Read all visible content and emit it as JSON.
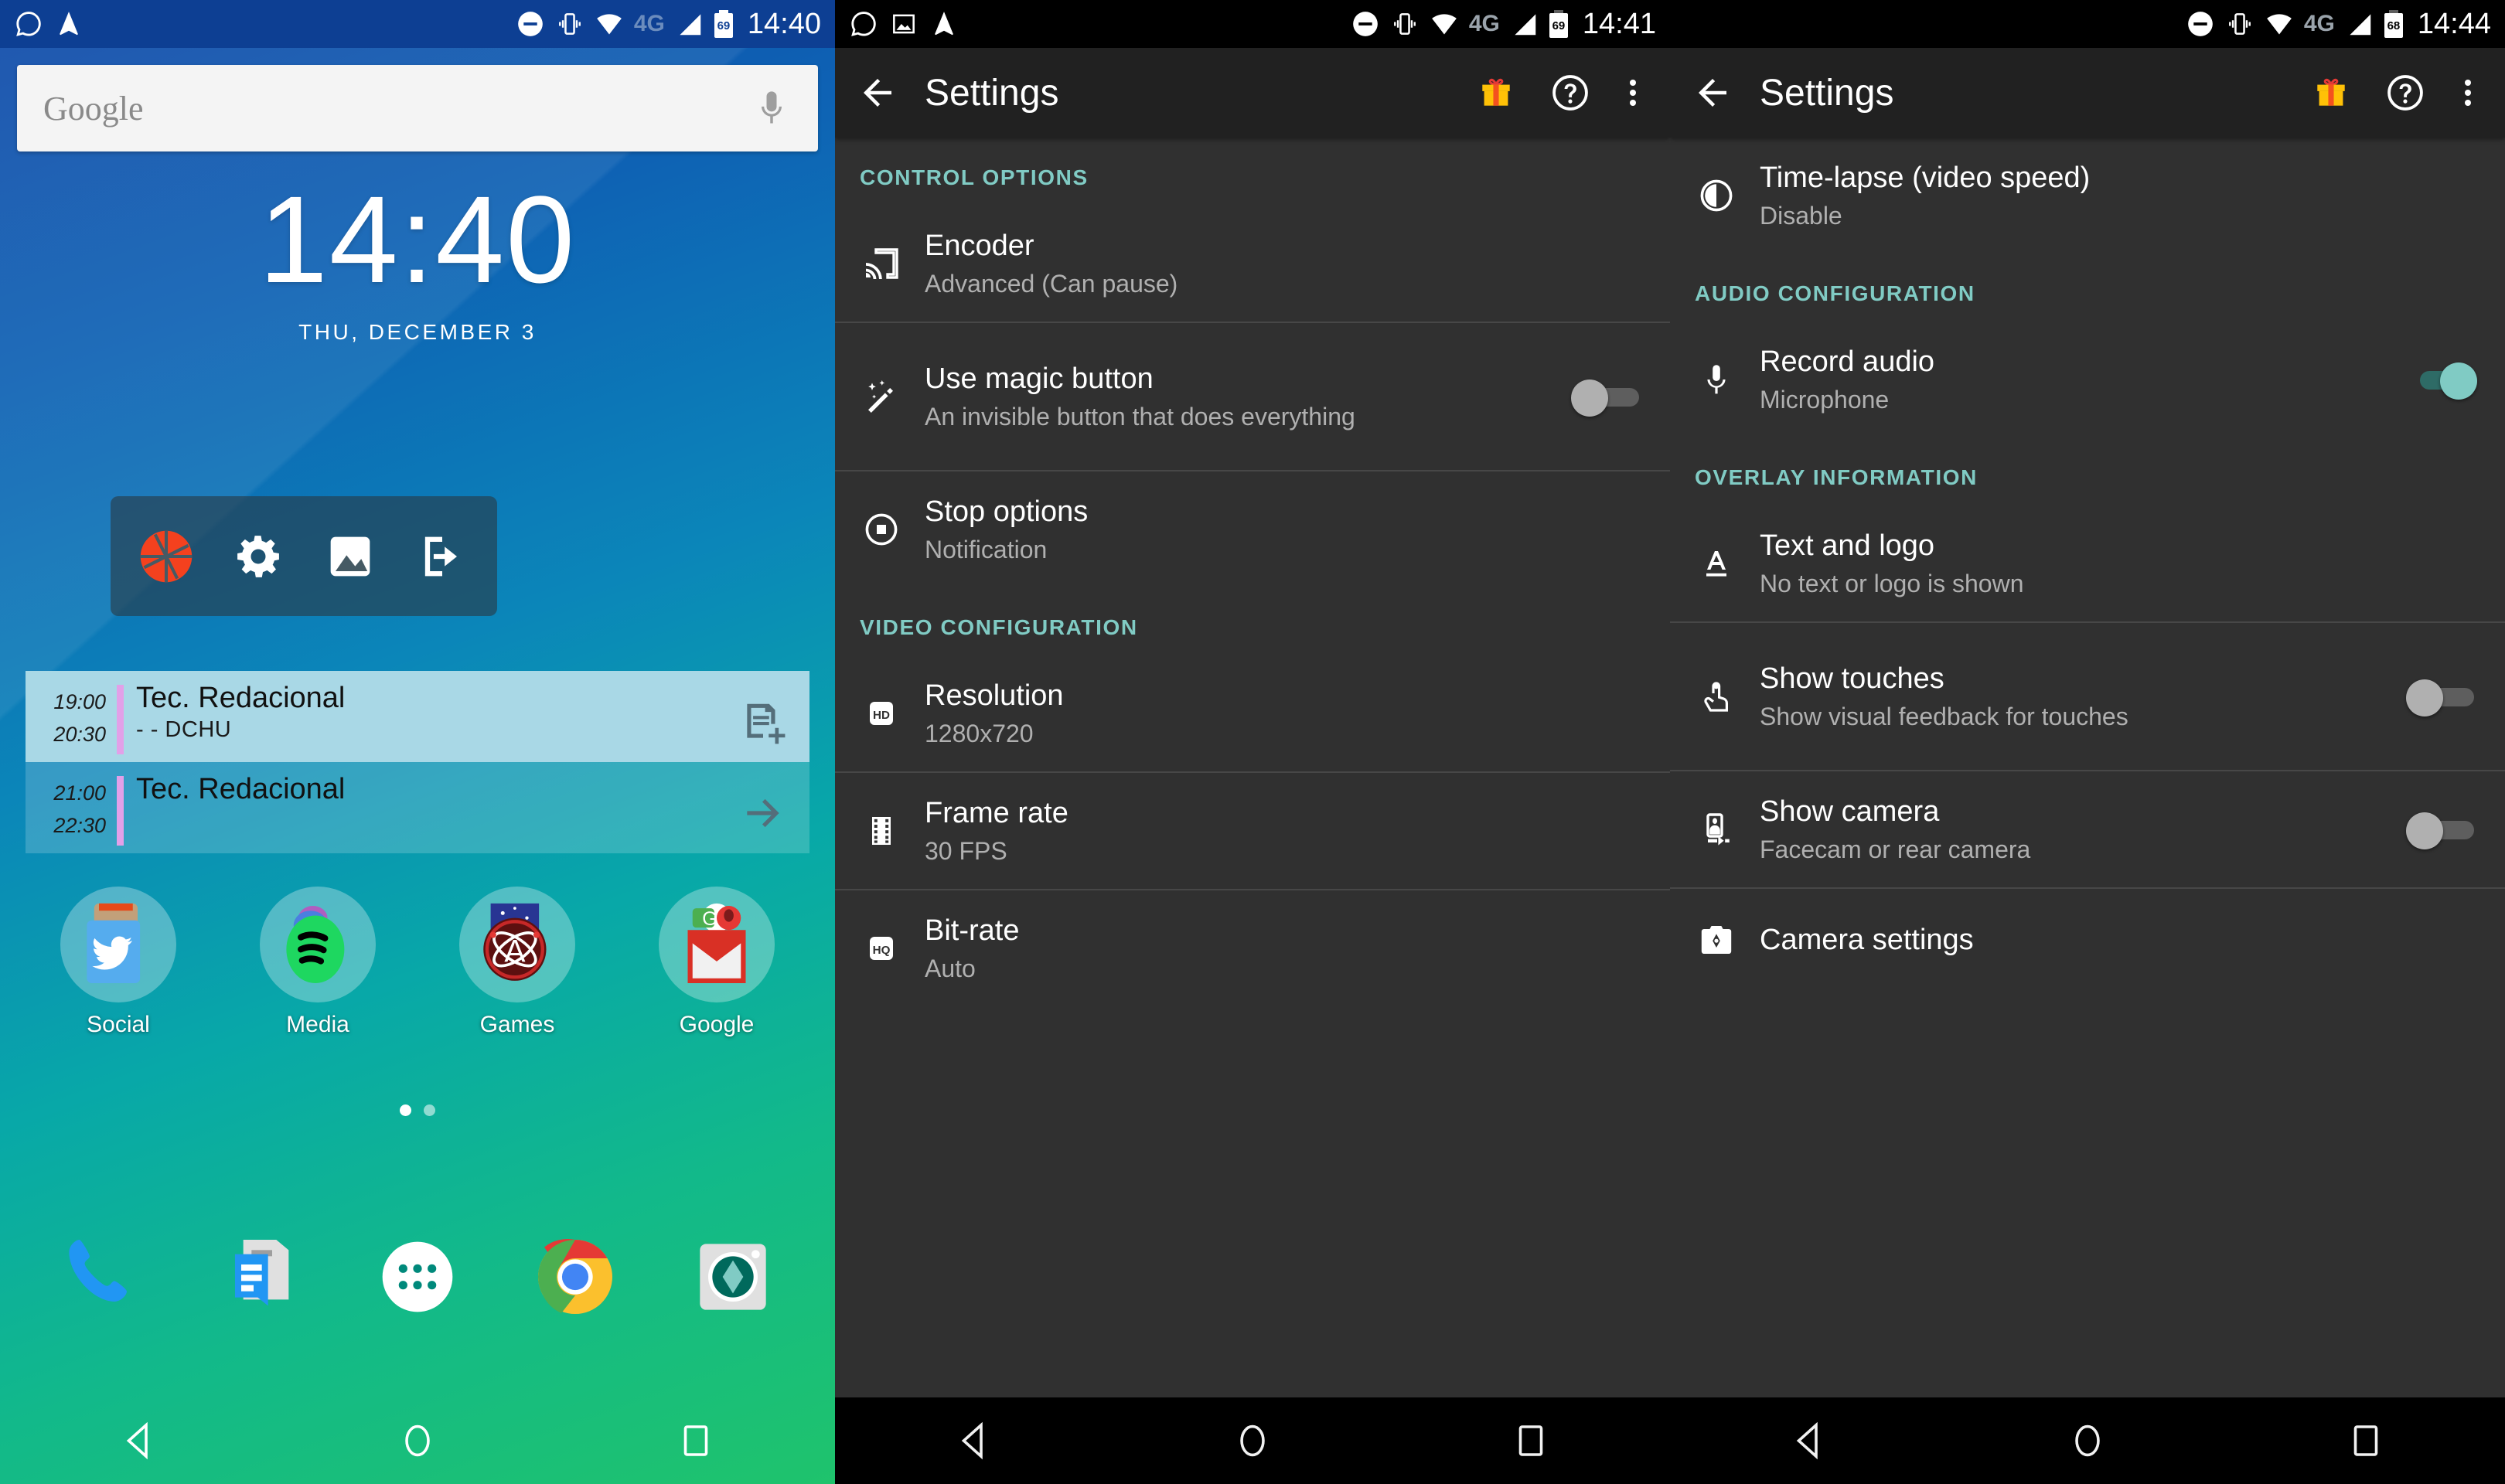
{
  "home": {
    "status_bar": {
      "time": "14:40",
      "battery_level": "69",
      "network": "4G",
      "left_icons": [
        "whatsapp-icon",
        "navigation-icon"
      ],
      "right_icons": [
        "do-not-disturb-icon",
        "vibrate-icon",
        "wifi-icon",
        "signal-icon",
        "battery-icon"
      ]
    },
    "search": {
      "label": "Google",
      "mic_icon": "microphone-icon"
    },
    "clock": {
      "time": "14:40",
      "date": "THU, DECEMBER 3"
    },
    "shortcut_bar": {
      "items": [
        "aperture-icon",
        "gear-icon",
        "gallery-icon",
        "exit-icon"
      ]
    },
    "calendar": {
      "events": [
        {
          "start": "19:00",
          "end": "20:30",
          "title": "Tec. Redacional",
          "subtitle": "- - DCHU",
          "action_icon": "new-event-icon"
        },
        {
          "start": "21:00",
          "end": "22:30",
          "title": "Tec. Redacional",
          "subtitle": "",
          "action_icon": "arrow-right-icon"
        }
      ]
    },
    "apps": [
      {
        "label": "Social",
        "icon": "twitter-folder-icon"
      },
      {
        "label": "Media",
        "icon": "spotify-folder-icon"
      },
      {
        "label": "Games",
        "icon": "games-folder-icon"
      },
      {
        "label": "Google",
        "icon": "gmail-folder-icon"
      }
    ],
    "page_dots": {
      "count": 2,
      "active_index": 0
    },
    "dock": [
      {
        "icon": "phone-icon"
      },
      {
        "icon": "messages-icon"
      },
      {
        "icon": "app-drawer-icon"
      },
      {
        "icon": "chrome-icon"
      },
      {
        "icon": "camera-icon"
      }
    ],
    "navbar": [
      "back-nav-icon",
      "home-nav-icon",
      "recents-nav-icon"
    ]
  },
  "settings_mid": {
    "status_bar": {
      "time": "14:41",
      "battery_level": "69",
      "network": "4G",
      "left_icons": [
        "whatsapp-icon",
        "screenshot-icon",
        "navigation-icon"
      ]
    },
    "toolbar": {
      "back_icon": "back-arrow-icon",
      "title": "Settings",
      "gift_icon": "gift-icon",
      "help_icon": "help-icon",
      "overflow_icon": "overflow-menu-icon"
    },
    "sections": [
      {
        "header": "CONTROL OPTIONS",
        "rows": [
          {
            "icon": "cast-icon",
            "title": "Encoder",
            "subtitle": "Advanced (Can pause)",
            "control": "none"
          },
          {
            "icon": "magic-wand-icon",
            "title": "Use magic button",
            "subtitle": "An invisible button that does everything",
            "control": "toggle",
            "toggle_on": false
          },
          {
            "icon": "stop-circle-icon",
            "title": "Stop options",
            "subtitle": "Notification",
            "control": "none"
          }
        ]
      },
      {
        "header": "VIDEO CONFIGURATION",
        "rows": [
          {
            "icon": "hd-icon",
            "title": "Resolution",
            "subtitle": "1280x720",
            "control": "none"
          },
          {
            "icon": "film-icon",
            "title": "Frame rate",
            "subtitle": "30 FPS",
            "control": "none"
          },
          {
            "icon": "hq-icon",
            "title": "Bit-rate",
            "subtitle": "Auto",
            "control": "none"
          }
        ]
      }
    ],
    "navbar": [
      "back-nav-icon",
      "home-nav-icon",
      "recents-nav-icon"
    ]
  },
  "settings_right": {
    "status_bar": {
      "time": "14:44",
      "battery_level": "68",
      "network": "4G",
      "left_icons": []
    },
    "toolbar": {
      "back_icon": "back-arrow-icon",
      "title": "Settings",
      "gift_icon": "gift-icon",
      "help_icon": "help-icon",
      "overflow_icon": "overflow-menu-icon"
    },
    "rows_top": [
      {
        "icon": "timelapse-icon",
        "title": "Time-lapse (video speed)",
        "subtitle": "Disable",
        "control": "none"
      }
    ],
    "sections": [
      {
        "header": "AUDIO CONFIGURATION",
        "rows": [
          {
            "icon": "microphone-icon",
            "title": "Record audio",
            "subtitle": "Microphone",
            "control": "toggle",
            "toggle_on": true
          }
        ]
      },
      {
        "header": "OVERLAY INFORMATION",
        "rows": [
          {
            "icon": "text-format-icon",
            "title": "Text and logo",
            "subtitle": "No text or logo is shown",
            "control": "none"
          },
          {
            "icon": "touch-icon",
            "title": "Show touches",
            "subtitle": "Show visual feedback for touches",
            "control": "toggle",
            "toggle_on": false
          },
          {
            "icon": "facecam-icon",
            "title": "Show camera",
            "subtitle": "Facecam or rear camera",
            "control": "toggle",
            "toggle_on": false
          },
          {
            "icon": "camera-settings-icon",
            "title": "Camera settings",
            "subtitle": "",
            "control": "none"
          }
        ]
      }
    ],
    "navbar": [
      "back-nav-icon",
      "home-nav-icon",
      "recents-nav-icon"
    ]
  },
  "colors": {
    "accent_teal": "#80cbc4",
    "settings_bg": "#303030",
    "toolbar_bg": "#212121",
    "status_bg_home": "#0d3f93",
    "calendar_stripe": "#e2a0e8"
  }
}
